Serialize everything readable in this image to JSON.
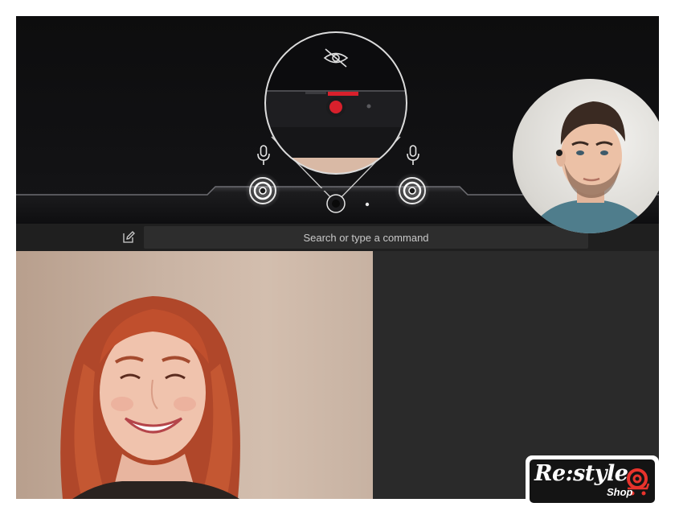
{
  "toolbar": {
    "search_placeholder": "Search or type a command"
  },
  "icons": {
    "privacy": "eye-slash-icon",
    "microphone": "microphone-icon",
    "compose": "compose-icon"
  },
  "colors": {
    "camera_red": "#d8202c",
    "bezel": "#141416",
    "titlebar": "#1f1f1f",
    "search_box": "#2d2d2d"
  },
  "branding": {
    "logo_main": "Re:style",
    "logo_sub": "Shop"
  }
}
